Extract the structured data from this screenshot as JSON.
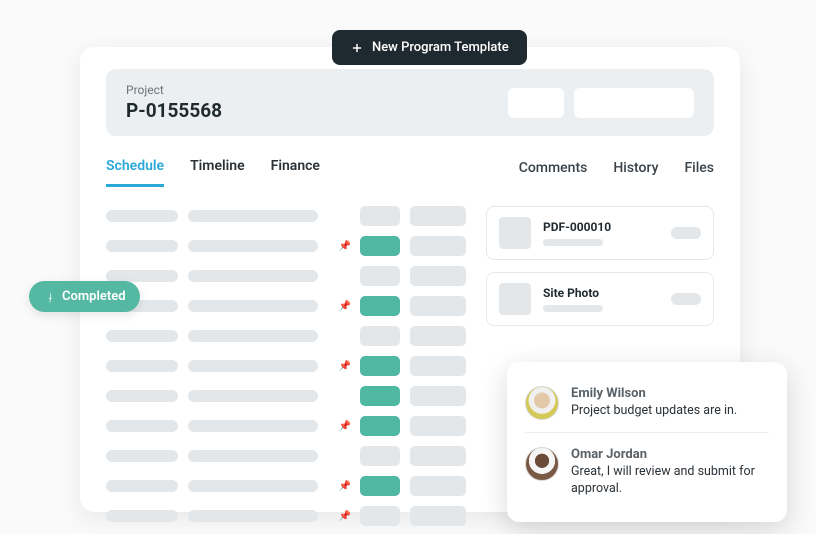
{
  "header_button": {
    "label": "New Program Template"
  },
  "project": {
    "label": "Project",
    "code": "P-0155568"
  },
  "tabs_left": [
    {
      "label": "Schedule",
      "active": true
    },
    {
      "label": "Timeline",
      "active": false
    },
    {
      "label": "Finance",
      "active": false
    }
  ],
  "tabs_right": [
    {
      "label": "Comments"
    },
    {
      "label": "History"
    },
    {
      "label": "Files"
    }
  ],
  "files": [
    {
      "title": "PDF-000010"
    },
    {
      "title": "Site Photo"
    }
  ],
  "status_pill": {
    "label": "Completed"
  },
  "comments": [
    {
      "name": "Emily Wilson",
      "text": "Project budget updates are in."
    },
    {
      "name": "Omar Jordan",
      "text": "Great, I will review and submit for approval."
    }
  ]
}
